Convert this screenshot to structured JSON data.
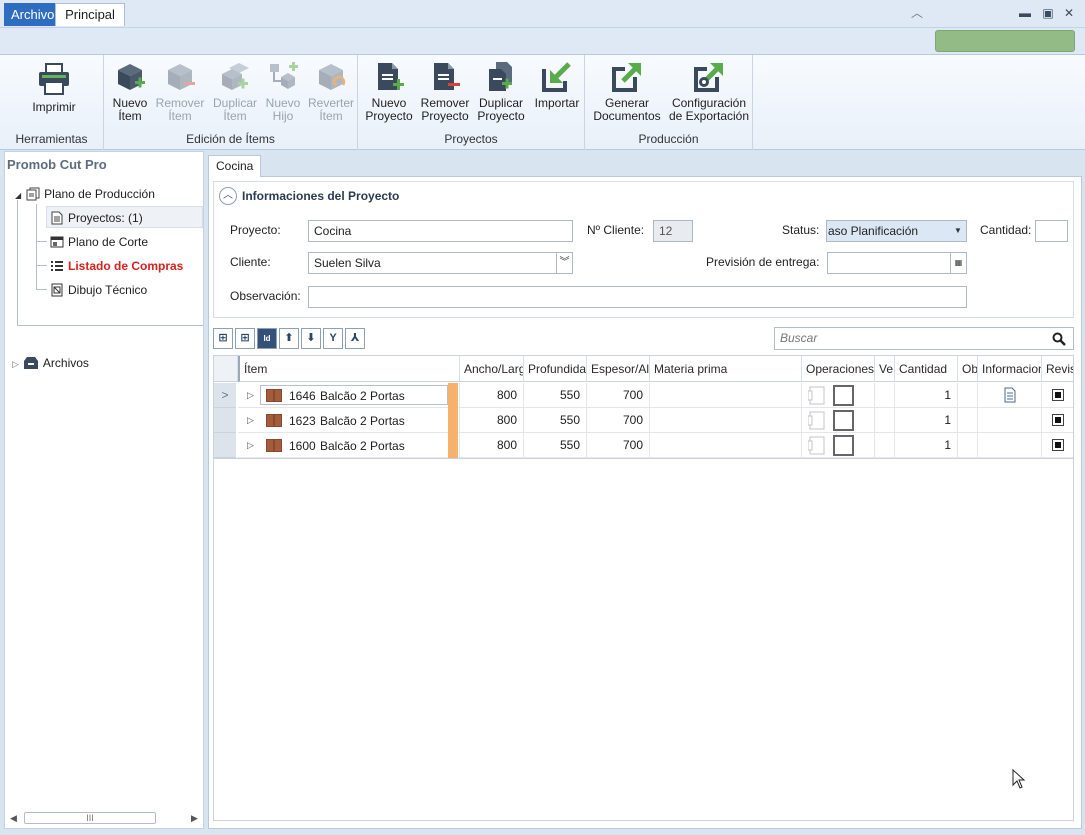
{
  "window": {
    "minimize": "▬",
    "maximize": "▣",
    "close": "✕"
  },
  "ribbon_tabs": {
    "archivo": "Archivo",
    "principal": "Principal"
  },
  "ribbon": {
    "groups": {
      "herramientas": "Herramientas",
      "edicion": "Edición de Ítems",
      "proyectos": "Proyectos",
      "produccion": "Producción"
    },
    "buttons": {
      "imprimir": "Imprimir",
      "nuevo_item_1": "Nuevo",
      "nuevo_item_2": "Ítem",
      "remover_item_1": "Remover",
      "remover_item_2": "Ítem",
      "duplicar_item_1": "Duplicar",
      "duplicar_item_2": "Ítem",
      "nuevo_hijo_1": "Nuevo",
      "nuevo_hijo_2": "Hijo",
      "revertir_item_1": "Reverter",
      "revertir_item_2": "Ítem",
      "nuevo_proyecto_1": "Nuevo",
      "nuevo_proyecto_2": "Proyecto",
      "remover_proyecto_1": "Remover",
      "remover_proyecto_2": "Proyecto",
      "duplicar_proyecto_1": "Duplicar",
      "duplicar_proyecto_2": "Proyecto",
      "importar": "Importar",
      "generar_1": "Generar",
      "generar_2": "Documentos",
      "config_1": "Configuración",
      "config_2": "de Exportación"
    }
  },
  "sidebar": {
    "title": "Promob Cut Pro",
    "plano_produccion": "Plano de Producción",
    "proyectos": "Proyectos: (1)",
    "plano_corte": "Plano de Corte",
    "listado_compras": "Listado de Compras",
    "dibujo_tecnico": "Dibujo Técnico",
    "archivos": "Archivos",
    "scroll_grip": "III"
  },
  "doc_tab": "Cocina",
  "info": {
    "title": "Informaciones del Proyecto",
    "proyecto_label": "Proyecto:",
    "proyecto_value": "Cocina",
    "cliente_num_label": "Nº Cliente:",
    "cliente_num_value": "12",
    "status_label": "Status:",
    "status_value": "aso Planificación",
    "cantidad_label": "Cantidad:",
    "cliente_label": "Cliente:",
    "cliente_value": "Suelen Silva",
    "prevision_label": "Previsión de entrega:",
    "observacion_label": "Observación:"
  },
  "toolbar": {
    "id_label": "Id",
    "search_placeholder": "Buscar"
  },
  "grid": {
    "headers": {
      "item": "Ítem",
      "ancho": "Ancho/Largo",
      "profundidad": "Profundidad",
      "espesor": "Espesor/Alto",
      "materia": "Materia prima",
      "operaciones": "Operaciones",
      "ve": "Ve",
      "cantidad": "Cantidad",
      "ob": "Ob",
      "informacion": "Informacion",
      "revis": "Revis"
    },
    "rows": [
      {
        "id": "1646",
        "name": "Balcão 2 Portas",
        "ancho": "800",
        "profundidad": "550",
        "espesor": "700",
        "cantidad": "1"
      },
      {
        "id": "1623",
        "name": "Balcão 2 Portas",
        "ancho": "800",
        "profundidad": "550",
        "espesor": "700",
        "cantidad": "1"
      },
      {
        "id": "1600",
        "name": "Balcão 2 Portas",
        "ancho": "800",
        "profundidad": "550",
        "espesor": "700",
        "cantidad": "1"
      }
    ]
  },
  "colors": {
    "accent": "#2f6dc0",
    "highlight_red": "#d9201e",
    "orange": "#f6b26b",
    "green": "#93bb86"
  }
}
